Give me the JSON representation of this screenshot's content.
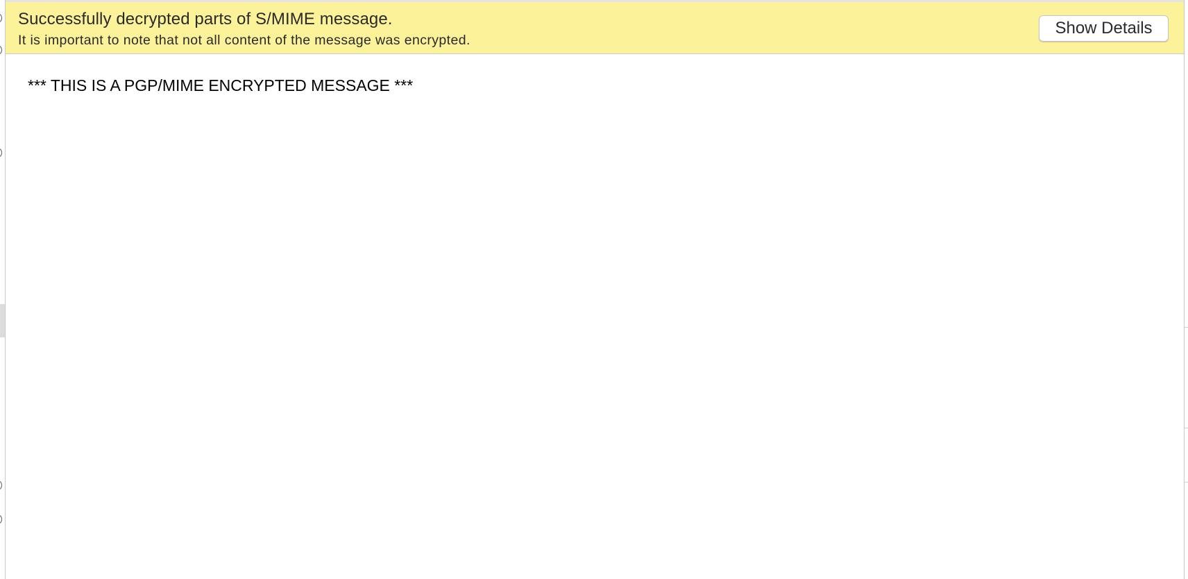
{
  "notification": {
    "title": "Successfully decrypted parts of S/MIME message.",
    "subtitle": "It is important to note that not all content of the message was encrypted.",
    "button_label": "Show Details",
    "background_color": "#fbf29a"
  },
  "message": {
    "body_text": "*** THIS IS A PGP/MIME ENCRYPTED MESSAGE ***"
  }
}
